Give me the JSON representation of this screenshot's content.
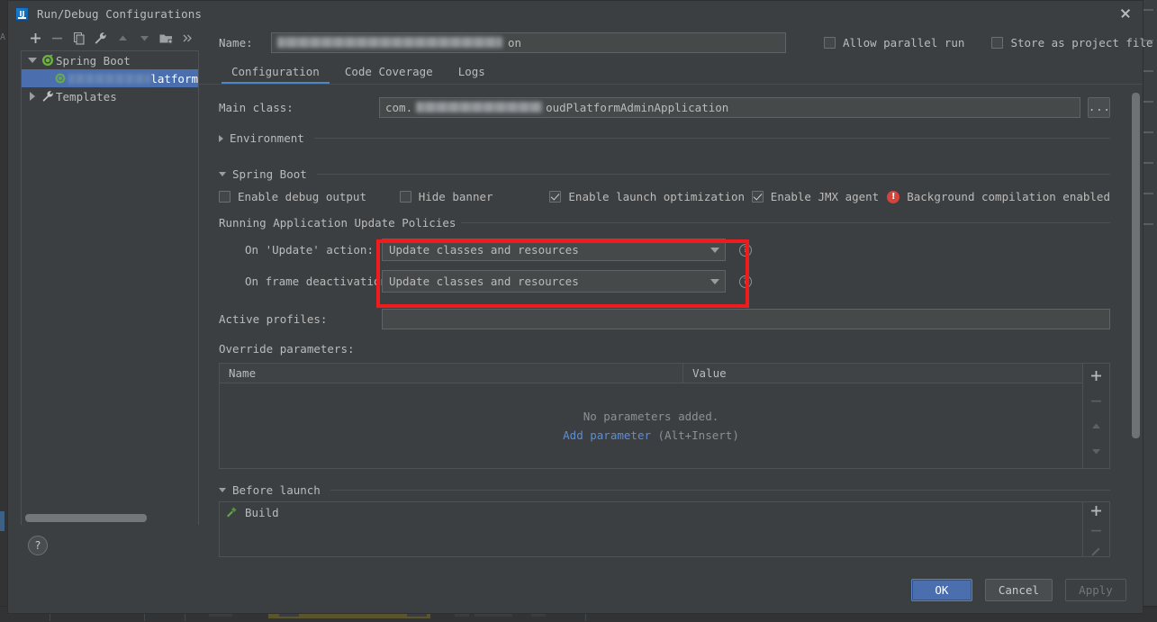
{
  "window": {
    "title": "Run/Debug Configurations",
    "app_icon": "intellij-idea-logo",
    "close_icon": "close-icon"
  },
  "left_panel": {
    "toolbar": [
      {
        "name": "add-configuration-button",
        "icon": "plus-icon",
        "label": "+"
      },
      {
        "name": "remove-configuration-button",
        "icon": "minus-icon",
        "label": "−"
      },
      {
        "name": "copy-configuration-button",
        "icon": "copy-icon",
        "label": "Copy"
      },
      {
        "name": "edit-templates-button",
        "icon": "wrench-icon",
        "label": "Edit Templates"
      },
      {
        "name": "move-up-button",
        "icon": "arrow-up-icon",
        "label": "Move Up"
      },
      {
        "name": "move-down-button",
        "icon": "arrow-down-icon",
        "label": "Move Down"
      },
      {
        "name": "new-folder-button",
        "icon": "folder-add-icon",
        "label": "New Folder"
      },
      {
        "name": "more-options-button",
        "icon": "chevron-double-right-icon",
        "label": "»"
      }
    ],
    "tree": [
      {
        "label": "Spring Boot",
        "icon": "spring-boot-icon",
        "expanded": true,
        "selected": false,
        "depth": 0
      },
      {
        "label": "latform",
        "icon": "spring-boot-run-icon",
        "expanded": false,
        "selected": true,
        "depth": 1,
        "redacted": true
      },
      {
        "label": "Templates",
        "icon": "wrench-icon",
        "expanded": false,
        "selected": false,
        "depth": 0
      }
    ],
    "help_button": {
      "name": "help-button",
      "label": "?"
    }
  },
  "header": {
    "name_label": "Name:",
    "name_value": "on",
    "name_value_redacted_prefix": "techCloudPlatfo",
    "allow_parallel_run": {
      "label": "Allow parallel run",
      "checked": false
    },
    "store_as_project_file": {
      "label": "Store as project file",
      "checked": false
    },
    "settings_icon": "gear-icon"
  },
  "tabs": [
    {
      "label": "Configuration",
      "active": true
    },
    {
      "label": "Code Coverage",
      "active": false
    },
    {
      "label": "Logs",
      "active": false
    }
  ],
  "configuration": {
    "main_class": {
      "label": "Main class:",
      "value_prefix": "com.",
      "value_suffix": "oudPlatformAdminApplication",
      "browse_button": "..."
    },
    "environment_section": {
      "label": "Environment",
      "expanded": false
    },
    "spring_boot_section": {
      "label": "Spring Boot",
      "expanded": true
    },
    "spring_boot_checks": [
      {
        "label": "Enable debug output",
        "checked": false,
        "name": "enable-debug-output-checkbox"
      },
      {
        "label": "Hide banner",
        "checked": false,
        "name": "hide-banner-checkbox"
      },
      {
        "label": "Enable launch optimization",
        "checked": true,
        "name": "enable-launch-optimization-checkbox"
      },
      {
        "label": "Enable JMX agent",
        "checked": true,
        "name": "enable-jmx-agent-checkbox"
      }
    ],
    "background_warning": {
      "icon": "warning-icon",
      "label": "Background compilation enabled"
    },
    "update_policies": {
      "title": "Running Application Update Policies",
      "on_update_action": {
        "label": "On 'Update' action:",
        "value": "Update classes and resources"
      },
      "on_frame_deactivation": {
        "label": "On frame deactivation:",
        "value": "Update classes and resources"
      },
      "help_icon": "question-mark-icon"
    },
    "active_profiles": {
      "label": "Active profiles:",
      "value": "",
      "placeholder": ""
    },
    "override_parameters": {
      "label": "Override parameters:",
      "columns": [
        "Name",
        "Value"
      ],
      "rows": [],
      "empty_text": "No parameters added.",
      "add_link": "Add parameter",
      "add_shortcut": "(Alt+Insert)",
      "side_buttons": [
        {
          "name": "add-parameter-button",
          "icon": "plus-icon",
          "enabled": true
        },
        {
          "name": "remove-parameter-button",
          "icon": "minus-icon",
          "enabled": false
        },
        {
          "name": "move-parameter-up-button",
          "icon": "arrow-up-icon",
          "enabled": false
        },
        {
          "name": "move-parameter-down-button",
          "icon": "arrow-down-icon",
          "enabled": false
        }
      ]
    },
    "before_launch": {
      "label": "Before launch",
      "expanded": true,
      "tasks": [
        {
          "label": "Build",
          "icon": "hammer-build-icon"
        }
      ],
      "side_buttons": [
        {
          "name": "add-task-button",
          "icon": "plus-icon",
          "enabled": true
        },
        {
          "name": "remove-task-button",
          "icon": "minus-icon",
          "enabled": false
        },
        {
          "name": "edit-task-button",
          "icon": "pencil-icon",
          "enabled": false
        }
      ]
    }
  },
  "footer": {
    "ok": "OK",
    "cancel": "Cancel",
    "apply": "Apply"
  },
  "annotation": {
    "highlight_color": "#ee1c1c",
    "target": "Running Application Update Policies dropdowns"
  },
  "colors": {
    "dialog_bg": "#3c3f41",
    "field_bg": "#45494a",
    "accent": "#4b6eaf",
    "tab_underline": "#4a88c7",
    "link": "#5b8ed6",
    "warning": "#d4433c",
    "text": "#bbbbbb"
  }
}
